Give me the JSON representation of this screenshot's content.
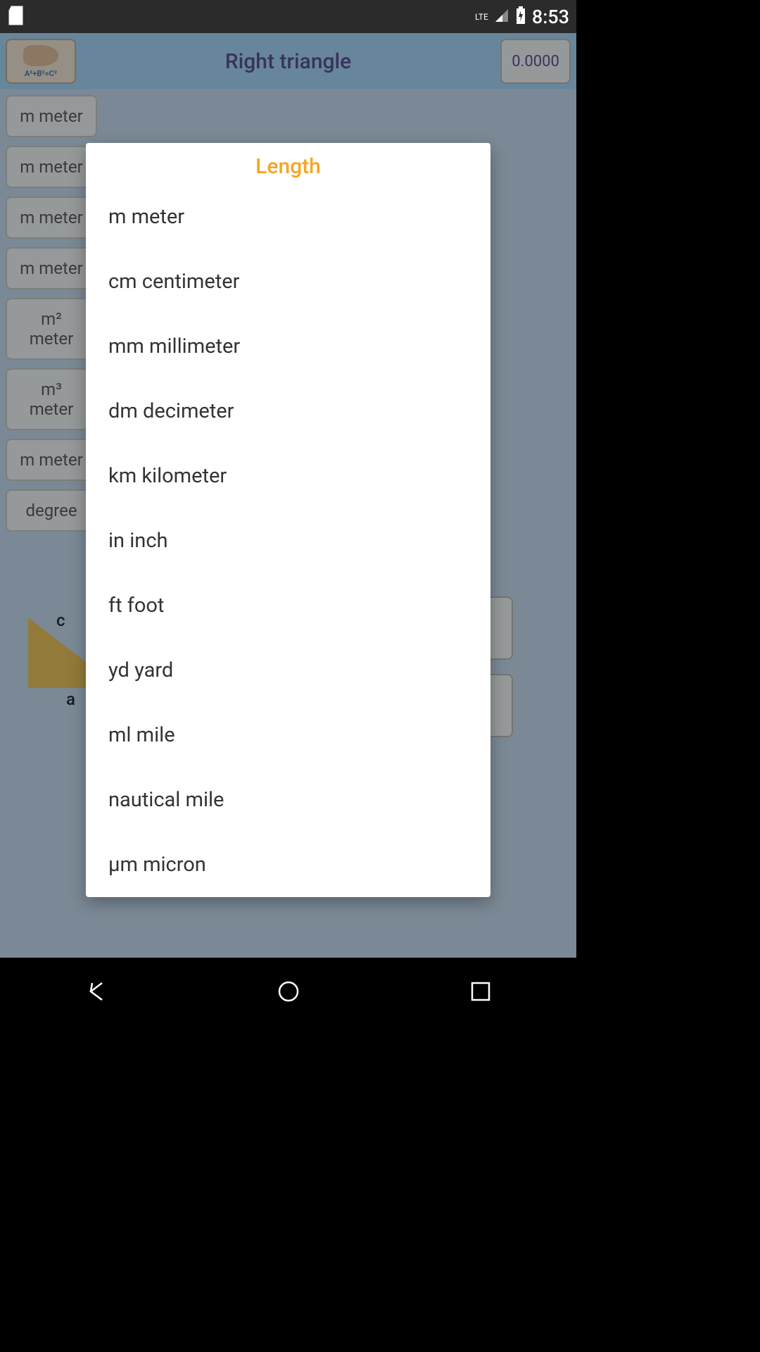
{
  "status": {
    "time": "8:53",
    "lte": "LTE"
  },
  "header": {
    "title": "Right triangle",
    "logo_formula": "A²+B²=C²",
    "value": "0.0000"
  },
  "sidebar": {
    "units": [
      "m meter",
      "m meter",
      "m meter",
      "m meter",
      "m² meter",
      "m³ meter",
      "m meter",
      "degree"
    ]
  },
  "triangle": {
    "c": "c",
    "a": "a"
  },
  "dialog": {
    "title": "Length",
    "items": [
      "m meter",
      "cm centimeter",
      "mm millimeter",
      "dm decimeter",
      "km kilometer",
      "in inch",
      "ft foot",
      "yd yard",
      "ml mile",
      "nautical mile",
      "µm micron"
    ]
  }
}
